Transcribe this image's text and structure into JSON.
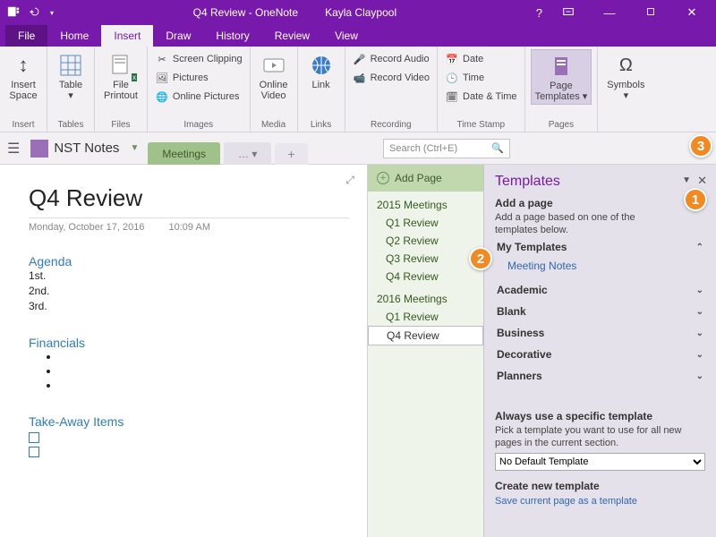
{
  "titlebar": {
    "title": "Q4 Review - OneNote",
    "user": "Kayla Claypool",
    "help": "?"
  },
  "tabs": {
    "file": "File",
    "items": [
      "Home",
      "Insert",
      "Draw",
      "History",
      "Review",
      "View"
    ],
    "activeIndex": 1
  },
  "ribbon": {
    "insertSpace": "Insert\nSpace",
    "table": "Table\n▾",
    "filePrintout": "File\nPrintout",
    "screenClipping": "Screen Clipping",
    "pictures": "Pictures",
    "onlinePictures": "Online Pictures",
    "onlineVideo": "Online\nVideo",
    "link": "Link\n ",
    "recordAudio": "Record Audio",
    "recordVideo": "Record Video",
    "date": "Date",
    "time": "Time",
    "dateTime": "Date & Time",
    "pageTemplates": "Page\nTemplates ▾",
    "symbols": "Symbols\n▾",
    "groups": {
      "insert": "Insert",
      "tables": "Tables",
      "files": "Files",
      "images": "Images",
      "media": "Media",
      "links": "Links",
      "recording": "Recording",
      "timestamp": "Time Stamp",
      "pages": "Pages"
    }
  },
  "nav": {
    "notebook": "NST Notes",
    "section": "Meetings",
    "moreTab": "… ▾",
    "search": "Search (Ctrl+E)"
  },
  "page": {
    "title": "Q4 Review",
    "date": "Monday, October 17, 2016",
    "time": "10:09 AM",
    "h_agenda": "Agenda",
    "agenda": [
      "1st.",
      "2nd.",
      "3rd."
    ],
    "h_fin": "Financials",
    "h_take": "Take-Away Items"
  },
  "pagelist": {
    "addPage": "Add Page",
    "groups": [
      {
        "head": "2015 Meetings",
        "items": [
          "Q1 Review",
          "Q2 Review",
          "Q3 Review",
          "Q4 Review"
        ]
      },
      {
        "head": "2016 Meetings",
        "items": [
          "Q1 Review",
          "Q4 Review"
        ]
      }
    ],
    "selected": "Q4 Review"
  },
  "templates": {
    "title": "Templates",
    "addPage": "Add a page",
    "addDesc": "Add a page based on one of the templates below.",
    "myTemplates": "My Templates",
    "meetingNotes": "Meeting Notes",
    "cats": [
      "Academic",
      "Blank",
      "Business",
      "Decorative",
      "Planners"
    ],
    "alwaysHead": "Always use a specific template",
    "alwaysDesc": "Pick a template you want to use for all new pages in the current section.",
    "defaultOption": "No Default Template",
    "createHead": "Create new template",
    "saveLink": "Save current page as a template"
  },
  "callouts": {
    "c1": "1",
    "c2": "2",
    "c3": "3"
  }
}
